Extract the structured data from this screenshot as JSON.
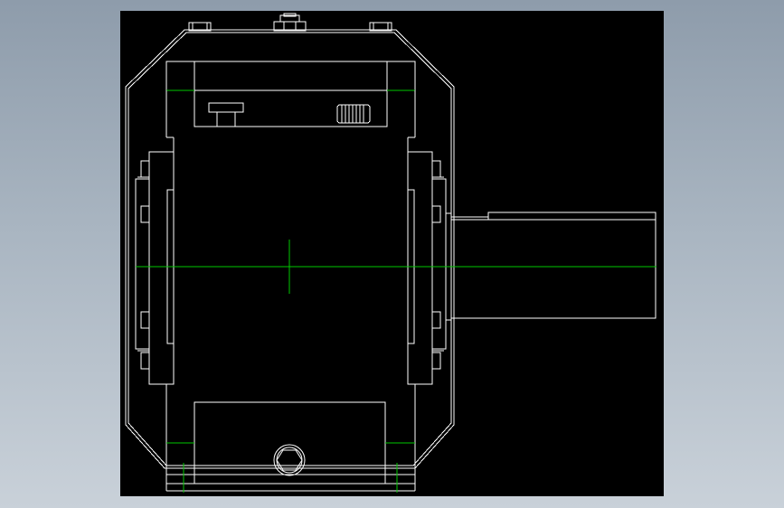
{
  "viewer": {
    "background_top": "#8e9cab",
    "background_bottom": "#c9d1d9",
    "canvas_color": "#000000"
  },
  "drawing": {
    "subject": "gearbox-housing-top-view",
    "line_color": "#ffffff",
    "centerline_color": "#00c800"
  }
}
